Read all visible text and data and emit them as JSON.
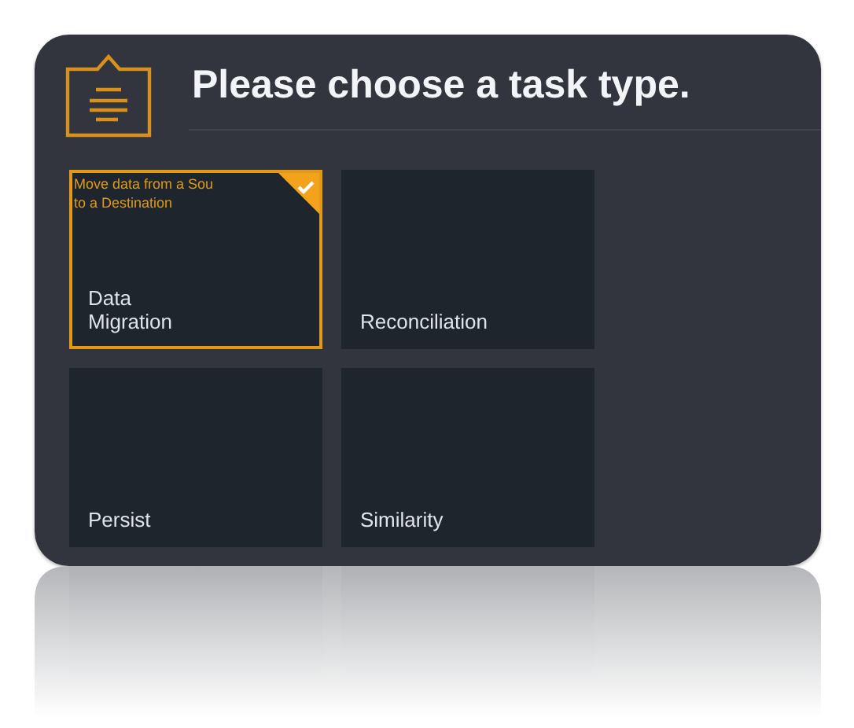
{
  "header": {
    "title": "Please choose a task type."
  },
  "tiles": [
    {
      "label": "Data\nMigration",
      "description": "Move data from a Sou\nto a Destination",
      "selected": true
    },
    {
      "label": "Reconciliation",
      "selected": false
    },
    {
      "label": "Persist",
      "selected": false
    },
    {
      "label": "Similarity",
      "selected": false
    }
  ]
}
